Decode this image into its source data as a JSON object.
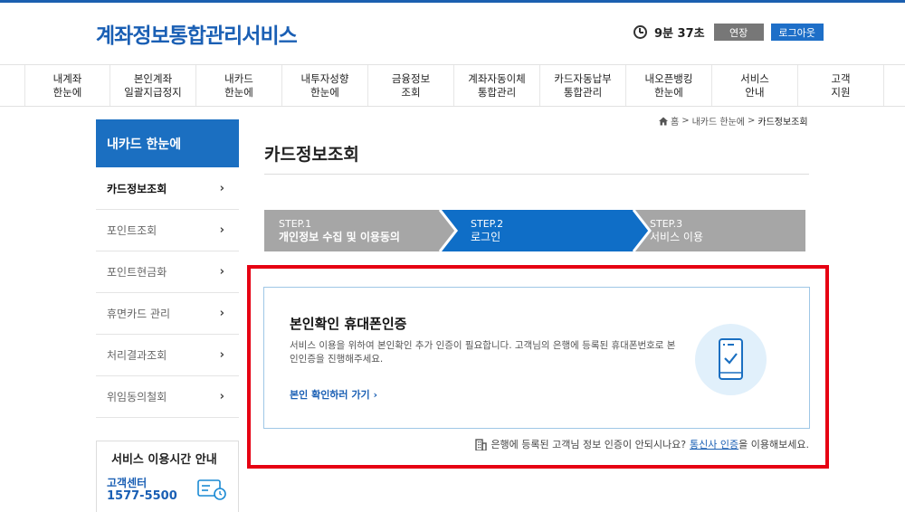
{
  "header": {
    "site_title": "계좌정보통합관리서비스",
    "timer": "9분 37초",
    "extend_label": "연장",
    "logout_label": "로그아웃"
  },
  "gnb": [
    "내계좌\n한눈에",
    "본인계좌\n일괄지급정지",
    "내카드\n한눈에",
    "내투자성향\n한눈에",
    "금융정보\n조회",
    "계좌자동이체\n통합관리",
    "카드자동납부\n통합관리",
    "내오픈뱅킹\n한눈에",
    "서비스\n안내",
    "고객\n지원"
  ],
  "lnb": {
    "title": "내카드 한눈에",
    "items": [
      "카드정보조회",
      "포인트조회",
      "포인트현금화",
      "휴면카드 관리",
      "처리결과조회",
      "위임동의철회"
    ]
  },
  "service_info": {
    "title": "서비스 이용시간 안내",
    "label": "고객센터",
    "phone": "1577-5500"
  },
  "breadcrumb": {
    "home": "홈",
    "level1": "내카드 한눈에",
    "current": "카드정보조회",
    "separator": ">"
  },
  "page_title": "카드정보조회",
  "steps": [
    {
      "num": "STEP.1",
      "label": "개인정보 수집 및 이용동의"
    },
    {
      "num": "STEP.2",
      "label": "로그인"
    },
    {
      "num": "STEP.3",
      "label": "서비스 이용"
    }
  ],
  "auth_card": {
    "title": "본인확인 휴대폰인증",
    "desc": "서비스 이용을 위하여 본인확인 추가 인증이 필요합니다. 고객님의 은행에 등록된 휴대폰번호로 본인인증을 진행해주세요.",
    "link": "본인 확인하러 가기"
  },
  "notice": {
    "prefix": "은행에 등록된 고객님 정보 인증이 안되시나요?",
    "link": "통신사 인증",
    "suffix": "을 이용해보세요."
  },
  "colors": {
    "brand": "#1b6fc1",
    "step_active": "#0f6ec7",
    "step_inactive": "#a6a6a6",
    "highlight_frame": "#e60012"
  }
}
